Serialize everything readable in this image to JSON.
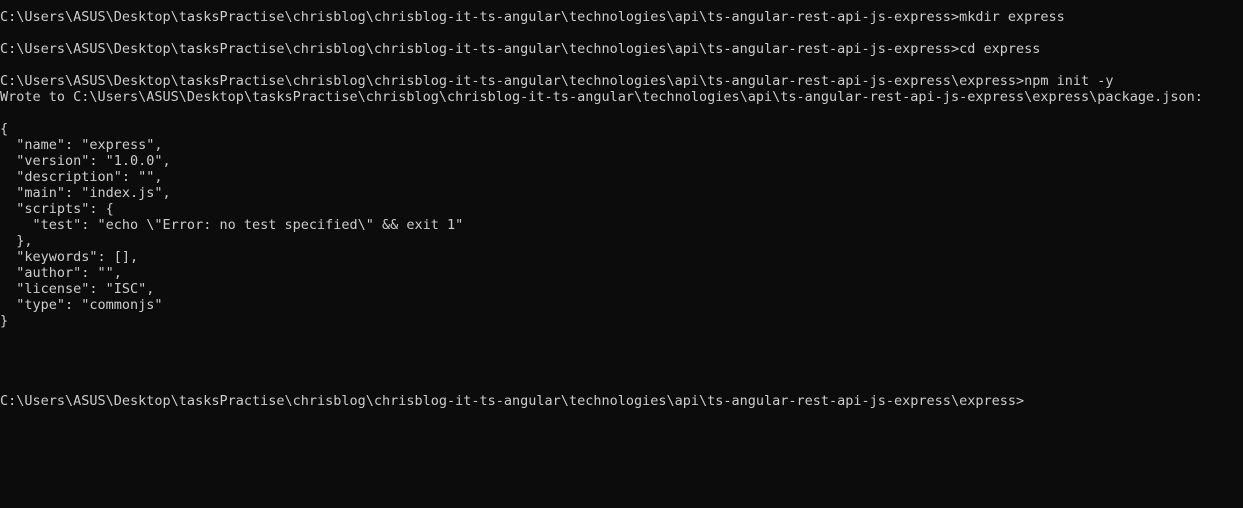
{
  "terminal": {
    "background": "#0c0c0c",
    "foreground": "#cccccc",
    "lines": [
      "C:\\Users\\ASUS\\Desktop\\tasksPractise\\chrisblog\\chrisblog-it-ts-angular\\technologies\\api\\ts-angular-rest-api-js-express>mkdir express",
      "",
      "C:\\Users\\ASUS\\Desktop\\tasksPractise\\chrisblog\\chrisblog-it-ts-angular\\technologies\\api\\ts-angular-rest-api-js-express>cd express",
      "",
      "C:\\Users\\ASUS\\Desktop\\tasksPractise\\chrisblog\\chrisblog-it-ts-angular\\technologies\\api\\ts-angular-rest-api-js-express\\express>npm init -y",
      "Wrote to C:\\Users\\ASUS\\Desktop\\tasksPractise\\chrisblog\\chrisblog-it-ts-angular\\technologies\\api\\ts-angular-rest-api-js-express\\express\\package.json:",
      "",
      "{",
      "  \"name\": \"express\",",
      "  \"version\": \"1.0.0\",",
      "  \"description\": \"\",",
      "  \"main\": \"index.js\",",
      "  \"scripts\": {",
      "    \"test\": \"echo \\\"Error: no test specified\\\" && exit 1\"",
      "  },",
      "  \"keywords\": [],",
      "  \"author\": \"\",",
      "  \"license\": \"ISC\",",
      "  \"type\": \"commonjs\"",
      "}",
      "",
      "",
      "",
      "",
      "C:\\Users\\ASUS\\Desktop\\tasksPractise\\chrisblog\\chrisblog-it-ts-angular\\technologies\\api\\ts-angular-rest-api-js-express\\express>"
    ]
  }
}
